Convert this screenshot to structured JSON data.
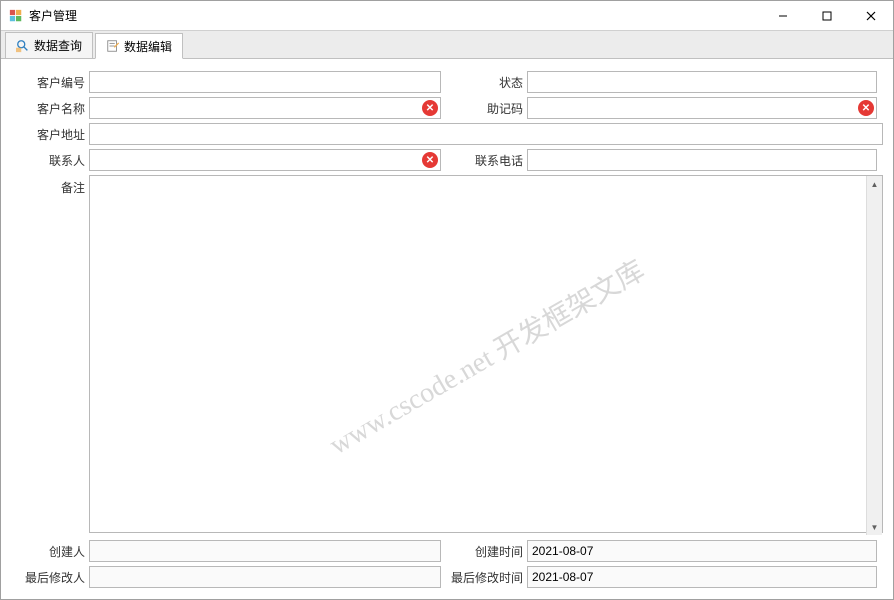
{
  "window": {
    "title": "客户管理"
  },
  "tabs": {
    "query": "数据查询",
    "edit": "数据编辑"
  },
  "labels": {
    "customerNo": "客户编号",
    "status": "状态",
    "customerName": "客户名称",
    "mnemonic": "助记码",
    "address": "客户地址",
    "contact": "联系人",
    "phone": "联系电话",
    "remark": "备注",
    "creator": "创建人",
    "createTime": "创建时间",
    "modifier": "最后修改人",
    "modifyTime": "最后修改时间"
  },
  "values": {
    "customerNo": "",
    "status": "",
    "customerName": "",
    "mnemonic": "",
    "address": "",
    "contact": "",
    "phone": "",
    "remark": "",
    "creator": "",
    "createTime": "2021-08-07",
    "modifier": "",
    "modifyTime": "2021-08-07"
  },
  "watermark": "www.cscode.net 开发框架文库"
}
